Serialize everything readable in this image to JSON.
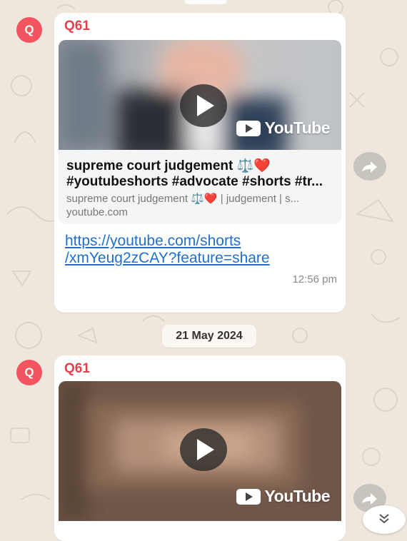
{
  "messages": [
    {
      "avatar_letter": "Q",
      "sender": "Q61",
      "video_badge": "YouTube",
      "preview_title_line1": "supreme court judgement ⚖️❤️",
      "preview_title_line2": "#youtubeshorts #advocate #shorts #tr...",
      "preview_description": "supreme court judgement ⚖️❤️ | judgement | s...",
      "preview_domain": "youtube.com",
      "link_line1": "https://youtube.com/shorts",
      "link_line2": "/xmYeug2zCAY?feature=share",
      "time": "12:56 pm"
    },
    {
      "avatar_letter": "Q",
      "sender": "Q61",
      "video_badge": "YouTube"
    }
  ],
  "date_separator": "21 May 2024",
  "icons": {
    "forward": "forward-icon",
    "play": "play-icon",
    "scroll_down": "double-chevron-down-icon"
  },
  "colors": {
    "avatar_bg": "#f4545f",
    "sender_name": "#e4404c",
    "link": "#1f6fd1",
    "chat_background": "#efe7dd"
  }
}
